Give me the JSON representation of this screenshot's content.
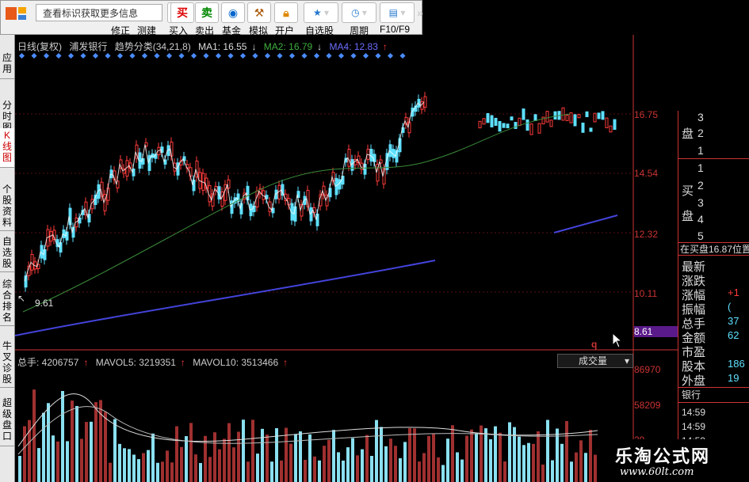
{
  "toolbar": {
    "search_text": "查看标识获取更多信息",
    "labels": [
      "修正",
      "测建",
      "买入",
      "卖出",
      "基金",
      "模拟",
      "开户",
      "自选股",
      "周期",
      "F10/F9"
    ],
    "buy_icon": "买",
    "sell_icon": "卖"
  },
  "sidebar": {
    "tabs": [
      "应用",
      "分时图",
      "K线图",
      "个股资料",
      "自选股",
      "综合排名",
      "牛叉诊股",
      "超级盘口"
    ]
  },
  "header": {
    "period": "日线(复权)",
    "stock": "浦发银行",
    "indicator": "趋势分类(34,21,8)",
    "ma1": "MA1: 16.55",
    "ma2": "MA2: 16.79",
    "ma4": "MA4: 12.83"
  },
  "price_axis": [
    "16.75",
    "14.54",
    "12.32",
    "10.11",
    "8.61"
  ],
  "low_label": "9.61",
  "volume": {
    "total": "总手: 4206757",
    "mavol5": "MAVOL5: 3219351",
    "mavol10": "MAVOL10: 3513466",
    "axis": [
      "86970",
      "58209",
      "29"
    ],
    "selector": "成交量",
    "q_marker": "q"
  },
  "right_panel": {
    "sell_label": "盘",
    "sell_rows": [
      "3",
      "2",
      "1"
    ],
    "buy_labels": [
      "买",
      "盘"
    ],
    "buy_rows": [
      "1",
      "2",
      "3",
      "4",
      "5"
    ],
    "inbuy": "在买盘16.87位置",
    "fields": [
      {
        "label": "最新",
        "value": ""
      },
      {
        "label": "涨跌",
        "value": ""
      },
      {
        "label": "涨幅",
        "value": "+1"
      },
      {
        "label": "振幅",
        "value": "("
      },
      {
        "label": "总手",
        "value": "37"
      },
      {
        "label": "金额",
        "value": "62"
      },
      {
        "label": "市盈",
        "value": ""
      },
      {
        "label": "股本",
        "value": "186"
      },
      {
        "label": "外盘",
        "value": "19"
      }
    ],
    "bank": "银行",
    "times": [
      "14:59",
      "14:59",
      "14:59"
    ]
  },
  "watermark": {
    "title": "乐淘公式网",
    "url": "www.60lt.com"
  },
  "colors": {
    "up": "#ff3b3b",
    "down": "#5ee0ff",
    "ma_white": "#ffffff",
    "ma_green": "#3a8a3a",
    "ma_blue": "#4444dd"
  }
}
